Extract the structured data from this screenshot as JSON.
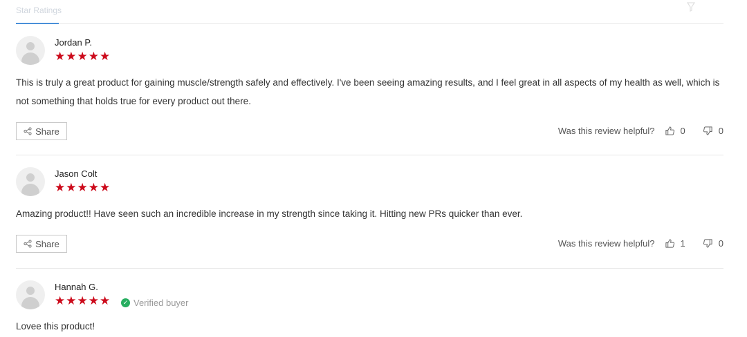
{
  "tabs": {
    "active_label": "Star Ratings"
  },
  "reviews": [
    {
      "author": "Jordan P.",
      "rating": 5,
      "stars": "★★★★★",
      "verified": false,
      "body": "This is truly a great product for gaining muscle/strength safely and effectively. I've been seeing amazing results, and I feel great in all aspects of my health as well, which is not something that holds true for every product out there.",
      "share_label": "Share",
      "helpful_label": "Was this review helpful?",
      "upvotes": "0",
      "downvotes": "0"
    },
    {
      "author": "Jason Colt",
      "rating": 5,
      "stars": "★★★★★",
      "verified": false,
      "body": "Amazing product!! Have seen such an incredible increase in my strength since taking it. Hitting new PRs quicker than ever.",
      "share_label": "Share",
      "helpful_label": "Was this review helpful?",
      "upvotes": "1",
      "downvotes": "0"
    },
    {
      "author": "Hannah G.",
      "rating": 5,
      "stars": "★★★★★",
      "verified": true,
      "verified_label": "Verified buyer",
      "body": "Lovee this product!"
    }
  ],
  "colors": {
    "star": "#cc0a1b",
    "verified_check": "#27ae60",
    "tab_underline": "#4a90d9"
  }
}
